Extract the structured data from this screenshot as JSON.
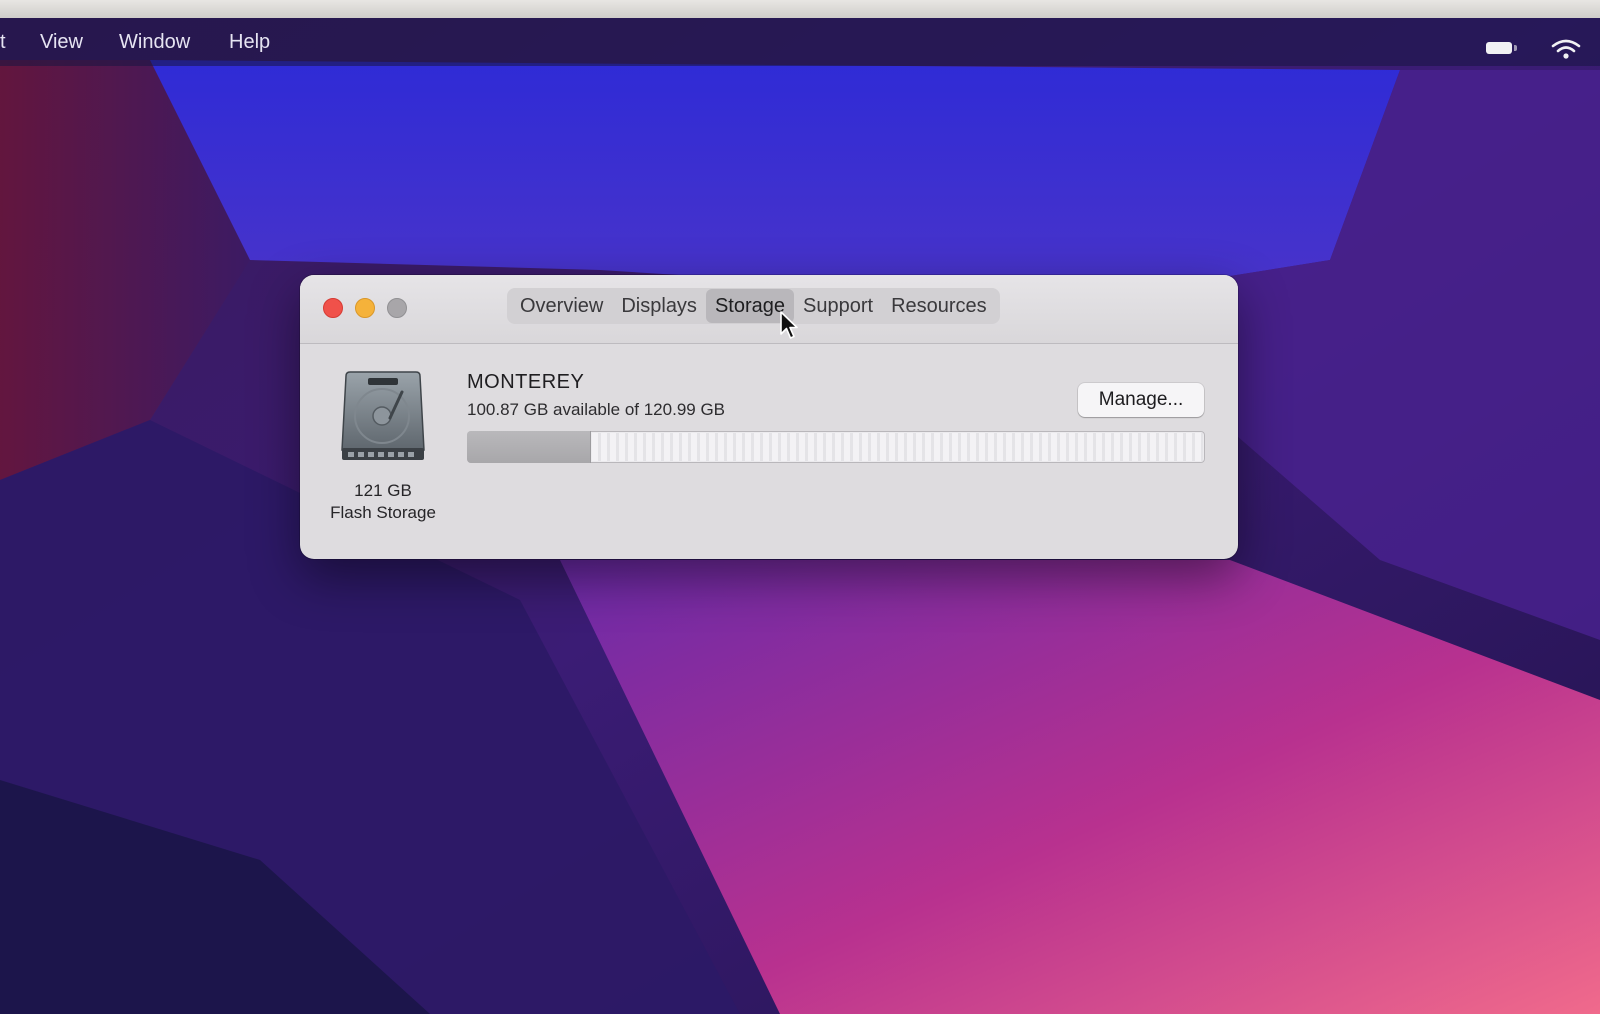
{
  "menubar": {
    "items": [
      "t",
      "View",
      "Window",
      "Help"
    ]
  },
  "window": {
    "tabs": [
      {
        "label": "Overview",
        "active": false
      },
      {
        "label": "Displays",
        "active": false
      },
      {
        "label": "Storage",
        "active": true
      },
      {
        "label": "Support",
        "active": false
      },
      {
        "label": "Resources",
        "active": false
      }
    ],
    "storage": {
      "disk_capacity": "121 GB",
      "disk_type": "Flash Storage",
      "volume_name": "MONTEREY",
      "availability": "100.87 GB available of 120.99 GB",
      "used_fraction": 0.166,
      "manage_label": "Manage..."
    }
  },
  "colors": {
    "close": "#f0514a",
    "minimize": "#f5b23a",
    "zoom": "#a8a6a9",
    "wallpaper_blue": "#3a2fd0",
    "wallpaper_magenta": "#c5318c"
  },
  "icons": [
    "battery-icon",
    "wifi-icon",
    "hard-disk-icon",
    "pointer-cursor-icon"
  ]
}
